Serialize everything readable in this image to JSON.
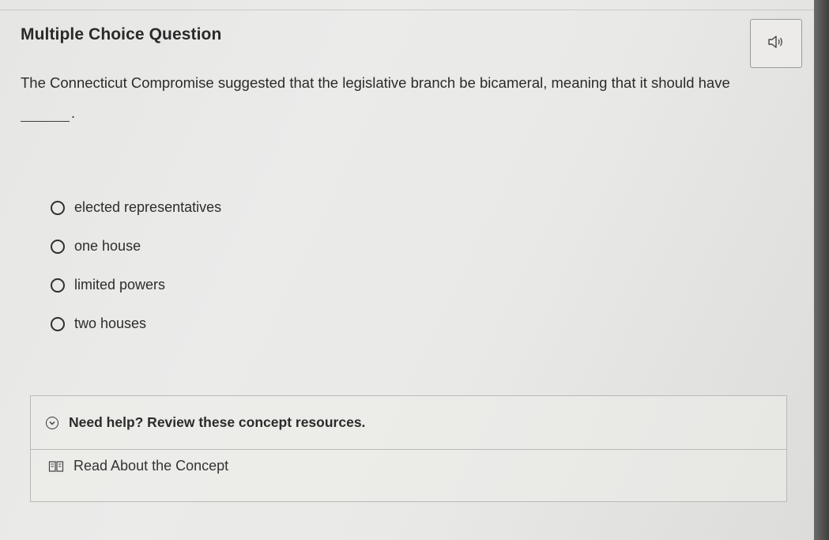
{
  "question": {
    "type_label": "Multiple Choice Question",
    "prompt": "The Connecticut Compromise suggested that the legislative branch be bicameral, meaning that it should have",
    "blank_suffix": "."
  },
  "audio": {
    "icon": "speaker-icon"
  },
  "options": [
    {
      "label": "elected representatives",
      "selected": false
    },
    {
      "label": "one house",
      "selected": false
    },
    {
      "label": "limited powers",
      "selected": false
    },
    {
      "label": "two houses",
      "selected": false
    }
  ],
  "help": {
    "title": "Need help? Review these concept resources.",
    "link_label": "Read About the Concept",
    "toggle_icon": "chevron-down-icon",
    "link_icon": "book-icon"
  }
}
